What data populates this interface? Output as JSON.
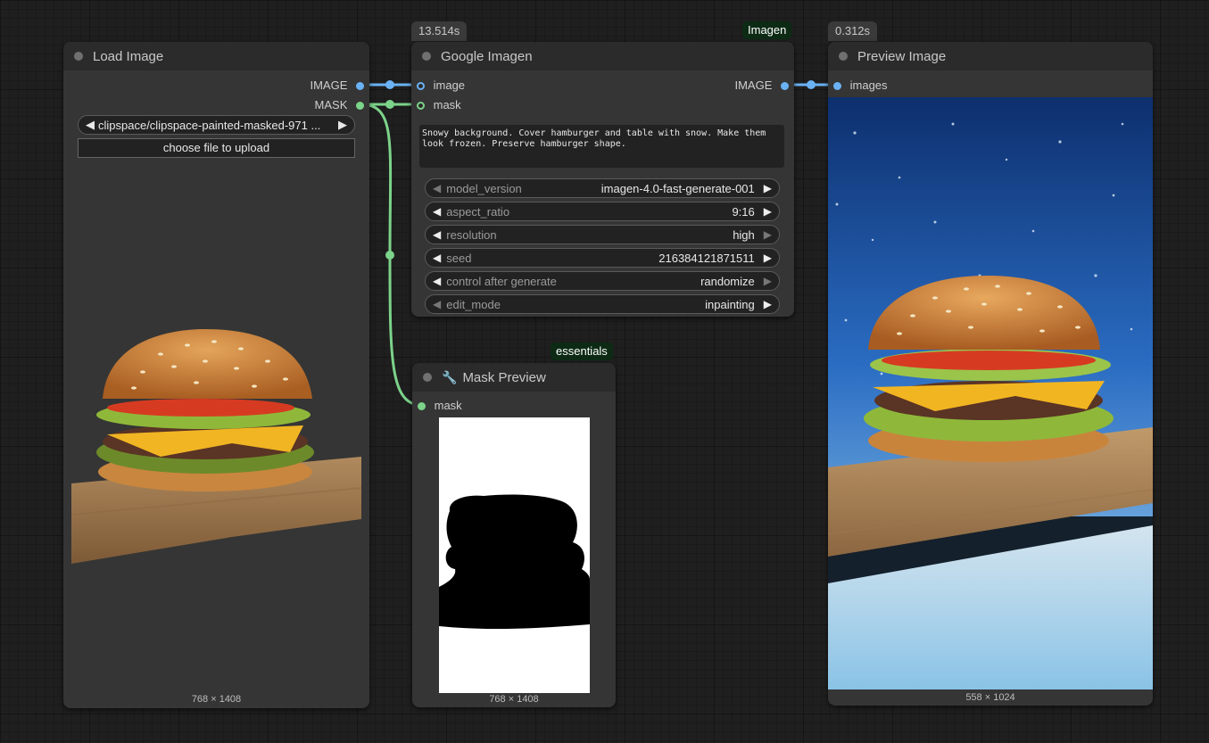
{
  "nodes": {
    "load_image": {
      "title": "Load Image",
      "outputs": [
        "IMAGE",
        "MASK"
      ],
      "image_file": "clipspace/clipspace-painted-masked-971 ...",
      "upload_label": "choose file to upload",
      "size_caption": "768 × 1408"
    },
    "google_imagen": {
      "title": "Google Imagen",
      "time_badge": "13.514s",
      "tag_badge": "Imagen",
      "inputs": [
        "image",
        "mask"
      ],
      "output": "IMAGE",
      "prompt": "Snowy background. Cover hamburger and table with snow. Make them look frozen. Preserve hamburger shape.",
      "widgets": [
        {
          "name": "model_version",
          "value": "imagen-4.0-fast-generate-001"
        },
        {
          "name": "aspect_ratio",
          "value": "9:16"
        },
        {
          "name": "resolution",
          "value": "high"
        },
        {
          "name": "seed",
          "value": "216384121871511"
        },
        {
          "name": "control after generate",
          "value": "randomize"
        },
        {
          "name": "edit_mode",
          "value": "inpainting"
        }
      ]
    },
    "mask_preview": {
      "title": "Mask Preview",
      "tag_badge": "essentials",
      "input": "mask",
      "size_caption": "768 × 1408"
    },
    "preview_image": {
      "title": "Preview Image",
      "time_badge": "0.312s",
      "input": "images",
      "size_caption": "558 × 1024"
    }
  },
  "colors": {
    "image_link": "#6ab2f4",
    "mask_link": "#7cd38a",
    "node_bg": "#353535",
    "title_bg": "#2b2b2b",
    "tag_bg": "#0c2a14"
  },
  "icons": [
    "arrow-left-icon",
    "arrow-right-icon",
    "wrench-icon",
    "status-dot-icon"
  ]
}
